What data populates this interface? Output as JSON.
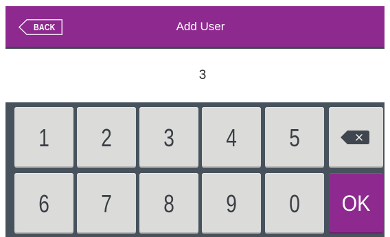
{
  "header": {
    "back_label": "BACK",
    "title": "Add User"
  },
  "entry": {
    "value": "3"
  },
  "keypad": {
    "row1": [
      "1",
      "2",
      "3",
      "4",
      "5"
    ],
    "row2": [
      "6",
      "7",
      "8",
      "9",
      "0"
    ],
    "backspace_icon": "backspace-icon",
    "ok_label": "OK"
  },
  "colors": {
    "accent": "#8e2a8f",
    "keypad_background": "#47525d",
    "key_face": "#dbdbd9"
  }
}
